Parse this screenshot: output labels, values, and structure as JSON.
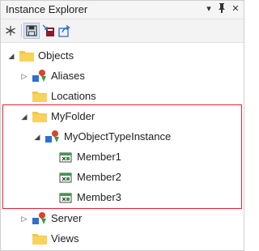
{
  "window": {
    "title": "Instance Explorer"
  },
  "titlebar_buttons": {
    "dropdown": "▾",
    "pin": "📌",
    "close": "✕"
  },
  "toolbar": {
    "buttons": [
      {
        "name": "asterisk-icon"
      },
      {
        "name": "save-icon"
      },
      {
        "name": "import-icon"
      },
      {
        "name": "export-icon"
      }
    ]
  },
  "tree": {
    "items": [
      {
        "label": "Objects",
        "icon": "folder-icon",
        "expander": "expanded"
      },
      {
        "label": "Aliases",
        "icon": "shapes-icon",
        "expander": "collapsed"
      },
      {
        "label": "Locations",
        "icon": "folder-icon",
        "expander": "none"
      },
      {
        "label": "MyFolder",
        "icon": "folder-icon",
        "expander": "expanded"
      },
      {
        "label": "MyObjectTypeInstance",
        "icon": "shapes-icon",
        "expander": "expanded"
      },
      {
        "label": "Member1",
        "icon": "member-icon",
        "expander": "none"
      },
      {
        "label": "Member2",
        "icon": "member-icon",
        "expander": "none"
      },
      {
        "label": "Member3",
        "icon": "member-icon",
        "expander": "none"
      },
      {
        "label": "Server",
        "icon": "shapes-icon",
        "expander": "collapsed"
      },
      {
        "label": "Views",
        "icon": "folder-icon",
        "expander": "none"
      }
    ]
  },
  "colors": {
    "highlight_border": "#e4232f",
    "folder": "#f3c547",
    "shapes_red": "#d8452a",
    "shapes_green": "#3c9a4a",
    "shapes_blue": "#2e6fcf"
  }
}
